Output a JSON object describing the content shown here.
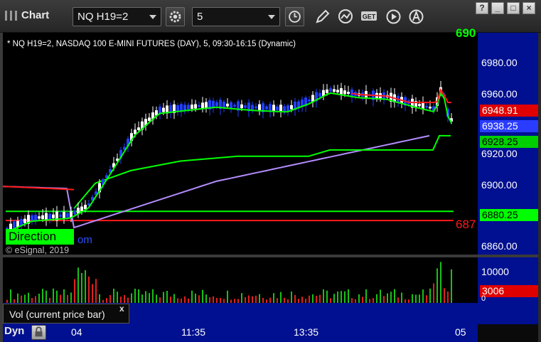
{
  "toolbar": {
    "title": "Chart",
    "symbol_value": "NQ H19=2",
    "interval_value": "5",
    "get_label": "GET",
    "window_buttons": [
      "?",
      "_",
      "□",
      "×"
    ]
  },
  "chart": {
    "header": "* NQ H19=2, NASDAQ 100 E-MINI FUTURES (DAY), 5, 09:30-16:15 (Dynamic)",
    "copyright": "© eSignal, 2019",
    "direction_text": "Direction",
    "direction_suffix": "om",
    "ref_red_text": "687",
    "top_green_text": "690",
    "colors": {
      "background": "#000000",
      "axis": "#001090",
      "up_candle": "#ffffff",
      "down_candle": "#2040ff",
      "ma_green": "#00ff00",
      "ma_red": "#ff1a1a",
      "vwap_purple": "#b48cff"
    }
  },
  "price_axis": {
    "ticks": [
      {
        "label": "6980.00",
        "value": 6980
      },
      {
        "label": "6960.00",
        "value": 6960
      },
      {
        "label": "6920.00",
        "value": 6920
      },
      {
        "label": "6900.00",
        "value": 6900
      },
      {
        "label": "6860.00",
        "value": 6860
      }
    ],
    "badges": [
      {
        "label": "6948.91",
        "value": 6948.91,
        "bg": "#e00000",
        "fg": "#ffffff"
      },
      {
        "label": "6938.25",
        "value": 6938.25,
        "bg": "#2a3cff",
        "fg": "#ffffff"
      },
      {
        "label": "6928.25",
        "value": 6928.25,
        "bg": "#00d000",
        "fg": "#000000"
      },
      {
        "label": "6880.25",
        "value": 6880.25,
        "bg": "#00ff00",
        "fg": "#000000"
      }
    ]
  },
  "volume": {
    "tab_label": "Vol (current price bar)",
    "close_symbol": "x",
    "tick_label": "10000",
    "zero_label": "0",
    "badge_label": "3006"
  },
  "time_axis": {
    "dyn_label": "Dyn",
    "labels": [
      {
        "label": "04",
        "x": 104
      },
      {
        "label": "11:35",
        "x": 255
      },
      {
        "label": "13:35",
        "x": 413
      },
      {
        "label": "05",
        "x": 642
      }
    ]
  },
  "chart_data": {
    "type": "candlestick",
    "ylim": [
      6853,
      6993
    ],
    "y_ticks": [
      6980,
      6960,
      6920,
      6900,
      6860
    ],
    "reference_lines": [
      {
        "value": 6880.25,
        "color": "#00ff00"
      },
      {
        "value": 6874.5,
        "color": "#ff1a1a"
      }
    ],
    "volume_ylim": [
      0,
      12000
    ]
  }
}
